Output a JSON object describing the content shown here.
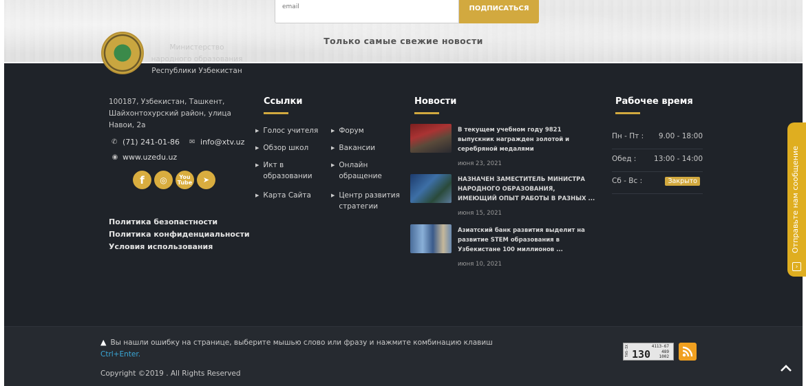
{
  "subscribe": {
    "email_placeholder": "email",
    "button_label": "ПОДПИСАТЬСЯ",
    "tagline": "Только самые свежие  новости"
  },
  "about": {
    "ministry_name": "Министерство народного образования Республики Узбекистан",
    "address": "100187, Узбекистан, Ташкент, Шайхонтохурский район, улица Навои, 2а",
    "phone": "(71) 241-01-86",
    "email": "info@xtv.uz",
    "website": "www.uzedu.uz"
  },
  "social": {
    "facebook": "f",
    "instagram": "◎",
    "youtube_top": "You",
    "youtube_bottom": "Tube",
    "telegram": "➤"
  },
  "policies": [
    "Политика безопастности",
    "Политика конфиденциальности",
    "Условия использования"
  ],
  "links": {
    "title": "Ссылки",
    "col1": [
      "Голос учителя",
      "Обзор школ",
      "Икт в образовании",
      "Карта Сайта"
    ],
    "col2": [
      "Форум",
      "Вакансии",
      "Онлайн обращение",
      "Центр развития стратегии"
    ]
  },
  "news": {
    "title": "Новости",
    "items": [
      {
        "title": "В текущем учебном году 9821 выпускник награжден золотой и серебряной медалями",
        "date": "июня 23, 2021"
      },
      {
        "title": "НАЗНАЧЕН ЗАМЕСТИТЕЛЬ МИНИСТРА НАРОДНОГО ОБРАЗОВАНИЯ, ИМЕЮЩИЙ ОПЫТ РАБОТЫ В РАЗНЫХ ...",
        "date": "июня 15, 2021"
      },
      {
        "title": "Азиатский банк развития выделит на развитие STEM образования в Узбекистане 100 миллионов ...",
        "date": "июня 10, 2021"
      }
    ]
  },
  "hours": {
    "title": "Рабочее время",
    "rows": [
      {
        "day": "Пн - Пт :",
        "value": "9.00 - 18:00"
      },
      {
        "day": "Обед :",
        "value": "13:00 - 14:00"
      },
      {
        "day": "Сб - Вс :",
        "value": "Закрыто"
      }
    ]
  },
  "bottom": {
    "error_note": "Вы нашли ошибку на странице, выберите мышью слово или фразу и нажмите комбинацию клавиш",
    "shortcut": "Ctrl+Enter.",
    "copyright": "Copyright ©2019 . All Rights Reserved"
  },
  "counter": {
    "main": "130",
    "line1": "4113-67",
    "line2": "489",
    "line3": "1002",
    "side": "TAS-IX"
  },
  "feedback": {
    "label": "Отправьте нам сообщение"
  },
  "icons": {
    "phone": "phone-icon",
    "email": "envelope-icon",
    "globe": "globe-icon",
    "warning": "warning-icon",
    "rss": "rss-icon",
    "scroll_top": "chevron-up-icon"
  },
  "colors": {
    "accent": "#d2a93f",
    "footer_bg": "#1f2329",
    "link_blue": "#3aa8d8"
  }
}
